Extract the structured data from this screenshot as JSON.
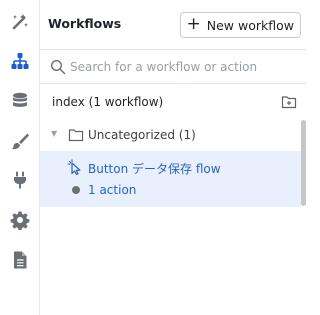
{
  "rail": {
    "items": [
      {
        "icon": "magic-wand-icon",
        "active": false
      },
      {
        "icon": "workflow-hierarchy-icon",
        "active": true
      },
      {
        "icon": "database-icon",
        "active": false
      },
      {
        "icon": "brush-icon",
        "active": false
      },
      {
        "icon": "plug-icon",
        "active": false
      },
      {
        "icon": "gear-icon",
        "active": false
      },
      {
        "icon": "document-icon",
        "active": false
      }
    ]
  },
  "header": {
    "title": "Workflows",
    "new_button_label": "New workflow"
  },
  "search": {
    "placeholder": "Search for a workflow or action",
    "value": ""
  },
  "index": {
    "label": "index (1 workflow)"
  },
  "group": {
    "label": "Uncategorized (1)",
    "expanded": true
  },
  "workflow": {
    "label": "Button データ保存 flow",
    "action_count_label": "1 action"
  },
  "colors": {
    "accent": "#2b62c7",
    "active_icon": "#1a5fd0",
    "inactive_icon": "#6b7075",
    "selected_row": "#e8f0fe"
  }
}
